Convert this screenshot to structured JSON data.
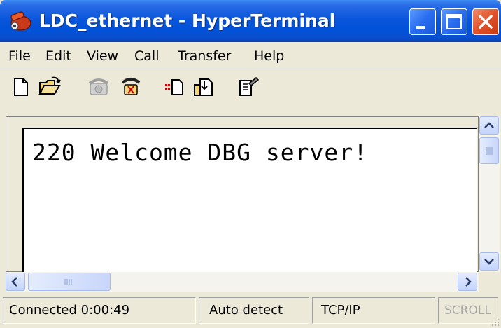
{
  "window": {
    "title": "LDC_ethernet - HyperTerminal",
    "icon": "hyperterminal-phone-icon",
    "controls": [
      "minimize-icon",
      "maximize-icon",
      "close-icon"
    ]
  },
  "menu": [
    "File",
    "Edit",
    "View",
    "Call",
    "Transfer",
    "Help"
  ],
  "toolbar": {
    "tools": [
      "new-document-icon",
      "open-folder-icon",
      "dial-icon",
      "disconnect-icon",
      "send-file-icon",
      "receive-file-icon",
      "properties-icon"
    ]
  },
  "terminal": {
    "text": "220 Welcome DBG server!"
  },
  "statusbar": {
    "connected": "Connected 0:00:49",
    "detect": "Auto detect",
    "protocol": "TCP/IP",
    "scroll": "SCROLL"
  },
  "colors": {
    "titlebar": "#0052d8",
    "close_button": "#e0532a",
    "window_bg": "#ece9d8"
  }
}
